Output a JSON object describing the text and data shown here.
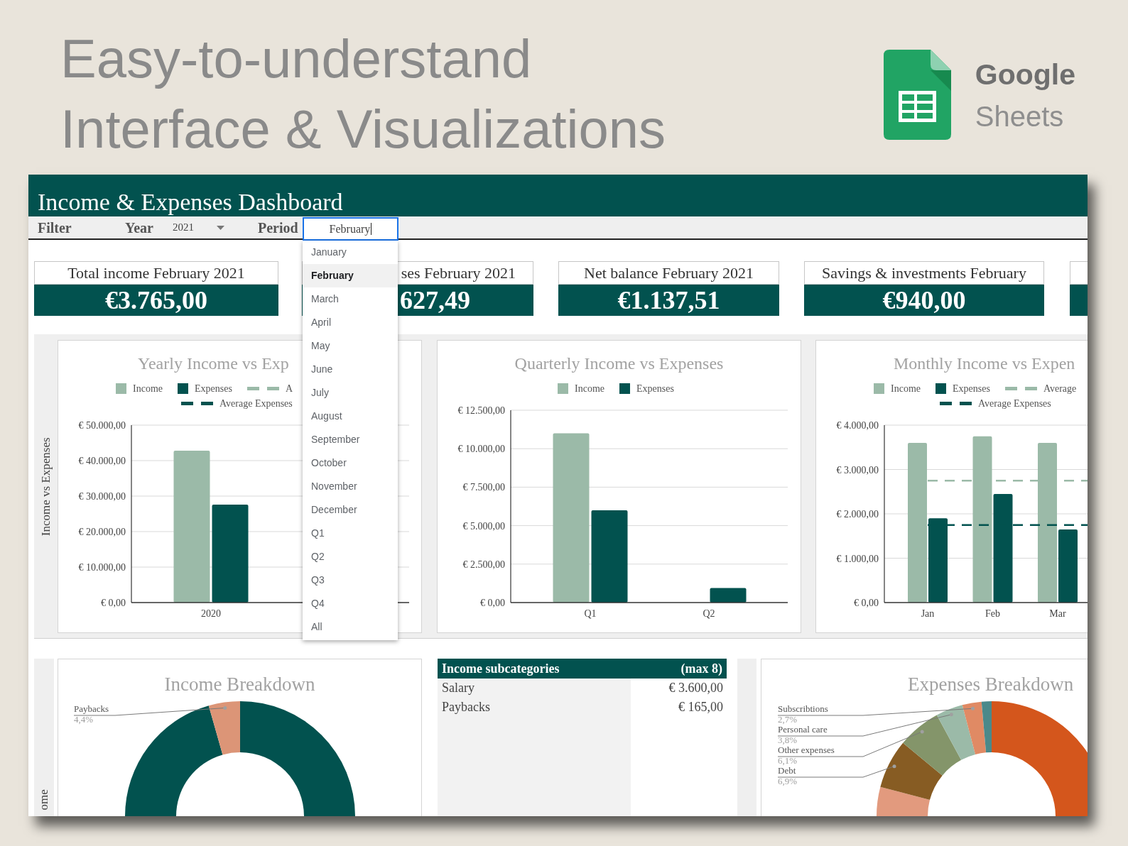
{
  "headline": {
    "lines": [
      "Easy-to-understand",
      "Interface & Visualizations"
    ]
  },
  "brand": {
    "lines": [
      "Google",
      "Sheets"
    ]
  },
  "dashboard": {
    "title": "Income & Expenses Dashboard",
    "filter_bar": {
      "label": "Filter",
      "year": {
        "label": "Year",
        "value": "2021"
      },
      "period": {
        "label": "Period",
        "value": "February"
      }
    },
    "period_options": [
      {
        "label": "January",
        "selected": false
      },
      {
        "label": "February",
        "selected": true
      },
      {
        "label": "March",
        "selected": false
      },
      {
        "label": "April",
        "selected": false
      },
      {
        "label": "May",
        "selected": false
      },
      {
        "label": "June",
        "selected": false
      },
      {
        "label": "July",
        "selected": false
      },
      {
        "label": "August",
        "selected": false
      },
      {
        "label": "September",
        "selected": false
      },
      {
        "label": "October",
        "selected": false
      },
      {
        "label": "November",
        "selected": false
      },
      {
        "label": "December",
        "selected": false
      },
      {
        "label": "Q1",
        "selected": false
      },
      {
        "label": "Q2",
        "selected": false
      },
      {
        "label": "Q3",
        "selected": false
      },
      {
        "label": "Q4",
        "selected": false
      },
      {
        "label": "All",
        "selected": false
      }
    ],
    "kpi_cards": [
      {
        "title": "Total income February 2021",
        "value": "€3.765,00"
      },
      {
        "title": "ses February 2021",
        "value": "627,49"
      },
      {
        "title": "Net balance February 2021",
        "value": "€1.137,51"
      },
      {
        "title": "Savings & investments February",
        "value": "€940,00"
      }
    ],
    "charts_section": {
      "label": "Income vs Expenses",
      "charts": [
        {
          "chart_data": {
            "type": "bar",
            "title": "Yearly Income vs Exp",
            "legend": "top",
            "grid": true,
            "categories": [
              "2020",
              null
            ],
            "series": [
              {
                "name": "Income",
                "color": "#9bbaa8",
                "values": [
                  42800,
                  null
                ]
              },
              {
                "name": "Expenses",
                "color": "#02524f",
                "values": [
                  27600,
                  null
                ]
              }
            ],
            "ref_lines": [
              {
                "axis": "y",
                "value": null,
                "label": "A",
                "color": "#9bbaa8"
              },
              {
                "axis": "y",
                "value": null,
                "label": "Average Expenses",
                "color": "#02524f"
              }
            ],
            "ylim": [
              0,
              50000
            ],
            "yticks": [
              {
                "value": 0,
                "label": "€ 0,00"
              },
              {
                "value": 10000,
                "label": "€ 10.000,00"
              },
              {
                "value": 20000,
                "label": "€ 20.000,00"
              },
              {
                "value": 30000,
                "label": "€ 30.000,00"
              },
              {
                "value": 40000,
                "label": "€ 40.000,00"
              },
              {
                "value": 50000,
                "label": "€ 50.000,00"
              }
            ]
          }
        },
        {
          "chart_data": {
            "type": "bar",
            "title": "Quarterly Income vs Expenses",
            "legend": "top",
            "grid": true,
            "categories": [
              "Q1",
              "Q2"
            ],
            "series": [
              {
                "name": "Income",
                "color": "#9bbaa8",
                "values": [
                  11000,
                  0
                ]
              },
              {
                "name": "Expenses",
                "color": "#02524f",
                "values": [
                  6000,
                  950
                ]
              }
            ],
            "ylim": [
              0,
              12500
            ],
            "yticks": [
              {
                "value": 0,
                "label": "€ 0,00"
              },
              {
                "value": 2500,
                "label": "€ 2.500,00"
              },
              {
                "value": 5000,
                "label": "€ 5.000,00"
              },
              {
                "value": 7500,
                "label": "€ 7.500,00"
              },
              {
                "value": 10000,
                "label": "€ 10.000,00"
              },
              {
                "value": 12500,
                "label": "€ 12.500,00"
              }
            ]
          }
        },
        {
          "chart_data": {
            "type": "bar",
            "title": "Monthly Income vs Expen",
            "legend": "top",
            "grid": true,
            "categories": [
              "Jan",
              "Feb",
              "Mar"
            ],
            "series": [
              {
                "name": "Income",
                "color": "#9bbaa8",
                "values": [
                  3600,
                  3750,
                  3600
                ]
              },
              {
                "name": "Expenses",
                "color": "#02524f",
                "values": [
                  1900,
                  2450,
                  1650
                ]
              }
            ],
            "ref_lines": [
              {
                "axis": "y",
                "value": 2750,
                "label": "Average",
                "color": "#9bbaa8"
              },
              {
                "axis": "y",
                "value": 1750,
                "label": "Average Expenses",
                "color": "#02524f"
              }
            ],
            "ylim": [
              0,
              4000
            ],
            "yticks": [
              {
                "value": 0,
                "label": "€ 0,00"
              },
              {
                "value": 1000,
                "label": "€ 1.000,00"
              },
              {
                "value": 2000,
                "label": "€ 2.000,00"
              },
              {
                "value": 3000,
                "label": "€ 3.000,00"
              },
              {
                "value": 4000,
                "label": "€ 4.000,00"
              }
            ]
          }
        }
      ]
    },
    "breakdown_section": {
      "label": "ome",
      "income_breakdown": {
        "title": "Income Breakdown",
        "slice_labels": [
          {
            "name": "Paybacks",
            "percent": "4,4%"
          }
        ]
      },
      "income_subcategories": {
        "title": "Income subcategories",
        "note": "(max 8)",
        "rows": [
          {
            "name": "Salary",
            "amount": "€ 3.600,00"
          },
          {
            "name": "Paybacks",
            "amount": "€ 165,00"
          }
        ]
      },
      "expenses_breakdown": {
        "title": "Expenses Breakdown",
        "slice_labels": [
          {
            "name": "Subscribtions",
            "percent": "2,7%"
          },
          {
            "name": "Personal care",
            "percent": "3,8%"
          },
          {
            "name": "Other expenses",
            "percent": "6,1%"
          },
          {
            "name": "Debt",
            "percent": "6,9%"
          }
        ]
      }
    }
  }
}
